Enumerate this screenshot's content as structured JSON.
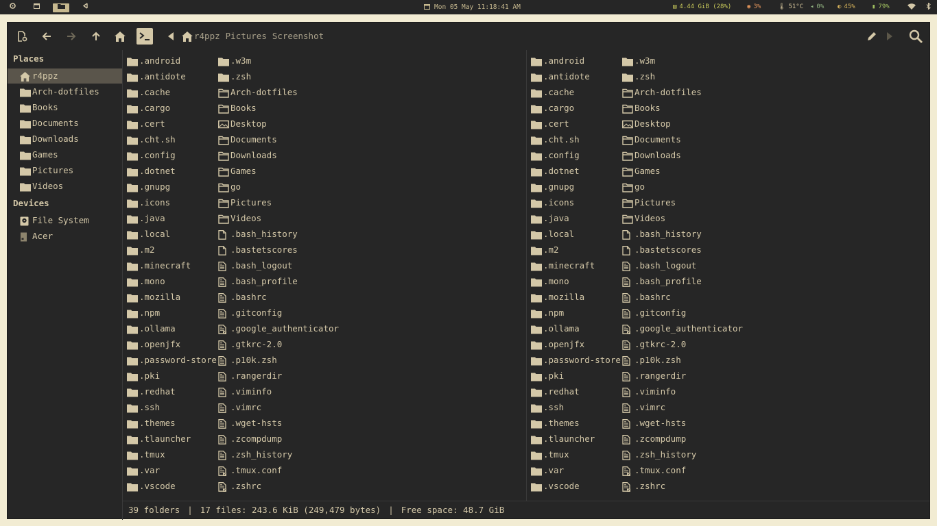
{
  "topbar": {
    "workspaces": [
      {
        "icon": "circle-launcher-icon",
        "active": false
      },
      {
        "icon": "terminal-icon",
        "active": false
      },
      {
        "icon": "folder-icon",
        "active": true
      },
      {
        "icon": "code-icon",
        "active": false
      }
    ],
    "clock": "Mon 05 May 11:18:41 AM",
    "memory": "4.44 GiB (28%)",
    "cpu": "3%",
    "temperature": "51°C",
    "volume": "0%",
    "brightness": "45%",
    "battery": "79%",
    "colors": {
      "memory": "#c7c85a",
      "cpu": "#e0935a",
      "temperature": "#d3c39a",
      "volume": "#8fb07f",
      "brightness": "#d3b05a",
      "battery": "#a0c060"
    }
  },
  "toolbar": {
    "breadcrumbs": [
      "r4ppz",
      "Pictures",
      "Screenshot"
    ]
  },
  "sidebar": {
    "places_heading": "Places",
    "places": [
      {
        "label": "r4ppz",
        "icon": "home-icon",
        "selected": true
      },
      {
        "label": "Arch-dotfiles",
        "icon": "folder-icon"
      },
      {
        "label": "Books",
        "icon": "folder-icon"
      },
      {
        "label": "Documents",
        "icon": "folder-icon"
      },
      {
        "label": "Downloads",
        "icon": "folder-icon"
      },
      {
        "label": "Games",
        "icon": "folder-icon"
      },
      {
        "label": "Pictures",
        "icon": "folder-icon"
      },
      {
        "label": "Videos",
        "icon": "folder-icon"
      }
    ],
    "devices_heading": "Devices",
    "devices": [
      {
        "label": "File System",
        "icon": "drive-icon"
      },
      {
        "label": "Acer",
        "icon": "usb-drive-icon"
      }
    ]
  },
  "files": {
    "col1": [
      {
        "name": ".android",
        "type": "folder"
      },
      {
        "name": ".antidote",
        "type": "folder"
      },
      {
        "name": ".cache",
        "type": "folder"
      },
      {
        "name": ".cargo",
        "type": "folder"
      },
      {
        "name": ".cert",
        "type": "folder"
      },
      {
        "name": ".cht.sh",
        "type": "folder"
      },
      {
        "name": ".config",
        "type": "folder"
      },
      {
        "name": ".dotnet",
        "type": "folder"
      },
      {
        "name": ".gnupg",
        "type": "folder"
      },
      {
        "name": ".icons",
        "type": "folder"
      },
      {
        "name": ".java",
        "type": "folder"
      },
      {
        "name": ".local",
        "type": "folder"
      },
      {
        "name": ".m2",
        "type": "folder"
      },
      {
        "name": ".minecraft",
        "type": "folder"
      },
      {
        "name": ".mono",
        "type": "folder"
      },
      {
        "name": ".mozilla",
        "type": "folder"
      },
      {
        "name": ".npm",
        "type": "folder"
      },
      {
        "name": ".ollama",
        "type": "folder"
      },
      {
        "name": ".openjfx",
        "type": "folder"
      },
      {
        "name": ".password-store",
        "type": "folder"
      },
      {
        "name": ".pki",
        "type": "folder"
      },
      {
        "name": ".redhat",
        "type": "folder"
      },
      {
        "name": ".ssh",
        "type": "folder"
      },
      {
        "name": ".themes",
        "type": "folder"
      },
      {
        "name": ".tlauncher",
        "type": "folder"
      },
      {
        "name": ".tmux",
        "type": "folder"
      },
      {
        "name": ".var",
        "type": "folder"
      },
      {
        "name": ".vscode",
        "type": "folder"
      }
    ],
    "col2": [
      {
        "name": ".w3m",
        "type": "folder"
      },
      {
        "name": ".zsh",
        "type": "folder"
      },
      {
        "name": "Arch-dotfiles",
        "type": "folder-outline"
      },
      {
        "name": "Books",
        "type": "folder-outline"
      },
      {
        "name": "Desktop",
        "type": "desktop"
      },
      {
        "name": "Documents",
        "type": "folder-outline"
      },
      {
        "name": "Downloads",
        "type": "folder-outline"
      },
      {
        "name": "Games",
        "type": "folder-outline"
      },
      {
        "name": "go",
        "type": "folder-outline"
      },
      {
        "name": "Pictures",
        "type": "folder-outline"
      },
      {
        "name": "Videos",
        "type": "folder-outline"
      },
      {
        "name": ".bash_history",
        "type": "file-empty"
      },
      {
        "name": ".bastetscores",
        "type": "file-empty"
      },
      {
        "name": ".bash_logout",
        "type": "file-text"
      },
      {
        "name": ".bash_profile",
        "type": "file-text"
      },
      {
        "name": ".bashrc",
        "type": "file-text"
      },
      {
        "name": ".gitconfig",
        "type": "file-text"
      },
      {
        "name": ".google_authenticator",
        "type": "file-link"
      },
      {
        "name": ".gtkrc-2.0",
        "type": "file-text"
      },
      {
        "name": ".p10k.zsh",
        "type": "file-text"
      },
      {
        "name": ".rangerdir",
        "type": "file-text"
      },
      {
        "name": ".viminfo",
        "type": "file-text"
      },
      {
        "name": ".vimrc",
        "type": "file-text"
      },
      {
        "name": ".wget-hsts",
        "type": "file-text"
      },
      {
        "name": ".zcompdump",
        "type": "file-text"
      },
      {
        "name": ".zsh_history",
        "type": "file-text"
      },
      {
        "name": ".tmux.conf",
        "type": "file-link"
      },
      {
        "name": ".zshrc",
        "type": "file-link"
      }
    ]
  },
  "status": {
    "folders": "39 folders",
    "files": "17 files: 243.6 KiB (249,479 bytes)",
    "free": "Free space: 48.7 GiB",
    "separator": "|"
  },
  "colors": {
    "accent": "#d4c8a8",
    "background": "#262626",
    "selected": "#5a554b"
  }
}
